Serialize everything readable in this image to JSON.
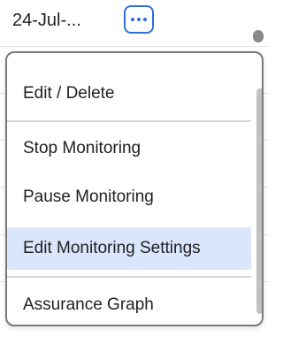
{
  "row": {
    "date_value": "24-Jul-...",
    "more_button_icon": "ellipsis-icon"
  },
  "menu": {
    "items": [
      {
        "label": "Edit / Delete",
        "selected": false
      },
      {
        "label": "Stop Monitoring",
        "selected": false
      },
      {
        "label": "Pause Monitoring",
        "selected": false
      },
      {
        "label": "Edit Monitoring Settings",
        "selected": true
      },
      {
        "label": "Assurance Graph",
        "selected": false
      }
    ]
  },
  "colors": {
    "accent": "#2f6fd6",
    "highlight": "#d9e6fb",
    "border": "#7a7a7a",
    "scrollbar": "#c2c2c2"
  }
}
